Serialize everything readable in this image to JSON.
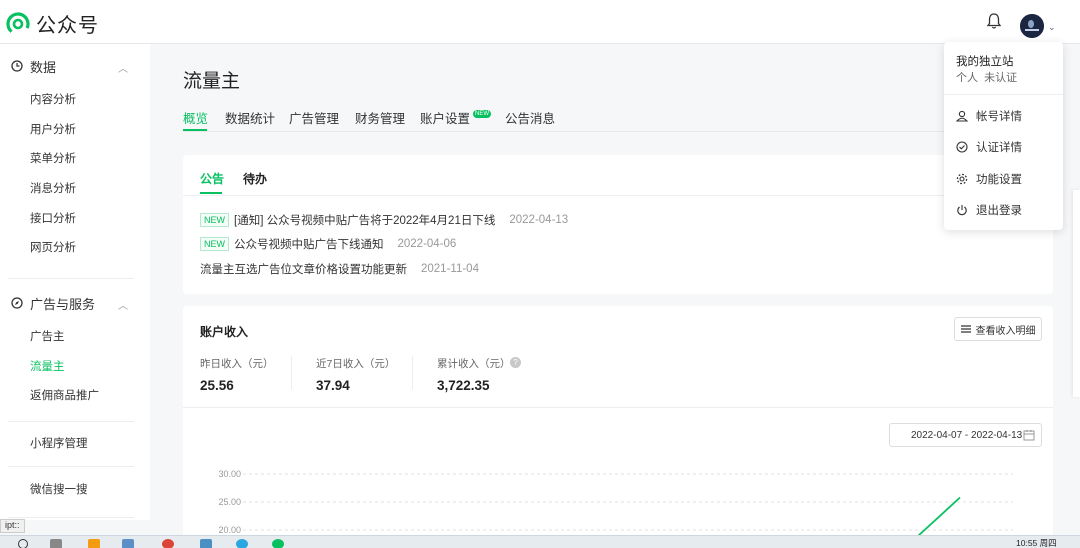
{
  "app": {
    "name": "公众号"
  },
  "header": {
    "bell_icon": "bell-icon",
    "avatar_icon": "avatar-icon"
  },
  "account_menu": {
    "name": "我的独立站",
    "type": "个人",
    "verify_status": "未认证",
    "items": [
      {
        "label": "帐号详情",
        "icon": "user-icon"
      },
      {
        "label": "认证详情",
        "icon": "check-circle-icon"
      },
      {
        "label": "功能设置",
        "icon": "gear-icon"
      },
      {
        "label": "退出登录",
        "icon": "power-icon"
      }
    ]
  },
  "sidebar": {
    "groups": [
      {
        "label": "数据",
        "icon": "clock-icon",
        "items": [
          "内容分析",
          "用户分析",
          "菜单分析",
          "消息分析",
          "接口分析",
          "网页分析"
        ]
      },
      {
        "label": "广告与服务",
        "icon": "compass-icon",
        "items": [
          "广告主",
          "流量主",
          "返佣商品推广"
        ]
      }
    ],
    "extra_items": [
      "小程序管理",
      "微信搜一搜"
    ],
    "active_item": "流量主"
  },
  "page": {
    "title": "流量主",
    "tabs": [
      "概览",
      "数据统计",
      "广告管理",
      "财务管理",
      "账户设置",
      "公告消息"
    ],
    "new_badge": "NEW",
    "active_tab": "概览"
  },
  "announcements": {
    "tabs": [
      "公告",
      "待办"
    ],
    "rows": [
      {
        "badge": "NEW",
        "text": "[通知] 公众号视频中贴广告将于2022年4月21日下线",
        "date": "2022-04-13"
      },
      {
        "badge": "NEW",
        "text": "公众号视频中贴广告下线通知",
        "date": "2022-04-06"
      },
      {
        "badge": "",
        "text": "流量主互选广告位文章价格设置功能更新",
        "date": "2021-11-04"
      }
    ]
  },
  "income": {
    "title": "账户收入",
    "detail_button": "查看收入明细",
    "stats": [
      {
        "label": "昨日收入（元）",
        "value": "25.56"
      },
      {
        "label": "近7日收入（元）",
        "value": "37.94"
      },
      {
        "label": "累计收入（元）",
        "value": "3,722.35"
      }
    ],
    "date_range": "2022-04-07 - 2022-04-13"
  },
  "chart_data": {
    "type": "line",
    "y_ticks": [
      "30.00",
      "25.00",
      "20.00"
    ],
    "ylim": [
      20,
      30
    ],
    "grid": true,
    "series": [
      {
        "values": [
          20,
          25.8
        ]
      }
    ]
  },
  "status_tip": "ipt::",
  "taskbar": {
    "clock": "10:55 周四"
  },
  "colors": {
    "accent": "#07c160"
  }
}
